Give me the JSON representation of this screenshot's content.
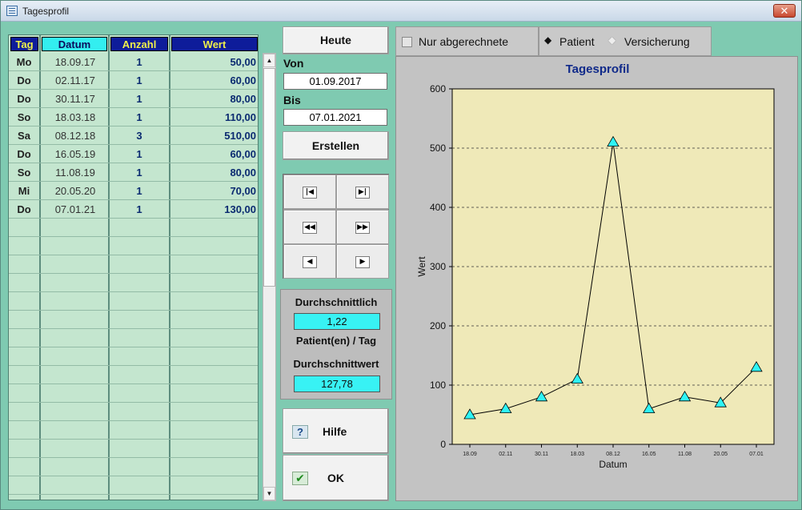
{
  "window": {
    "title": "Tagesprofil",
    "close_label": "✕"
  },
  "table": {
    "headers": {
      "tag": "Tag",
      "datum": "Datum",
      "anzahl": "Anzahl",
      "wert": "Wert"
    },
    "header_colors": {
      "tag": "#0e1c9a",
      "datum": "#33eef0",
      "anzahl": "#0e1c9a",
      "wert": "#0e1c9a"
    },
    "header_text_colors": {
      "tag": "#f0f04a",
      "datum": "#0a0a5a",
      "anzahl": "#f0f04a",
      "wert": "#f0f04a"
    },
    "rows": [
      {
        "tag": "Mo",
        "datum": "18.09.17",
        "anzahl": "1",
        "wert": "50,00"
      },
      {
        "tag": "Do",
        "datum": "02.11.17",
        "anzahl": "1",
        "wert": "60,00"
      },
      {
        "tag": "Do",
        "datum": "30.11.17",
        "anzahl": "1",
        "wert": "80,00"
      },
      {
        "tag": "So",
        "datum": "18.03.18",
        "anzahl": "1",
        "wert": "110,00"
      },
      {
        "tag": "Sa",
        "datum": "08.12.18",
        "anzahl": "3",
        "wert": "510,00"
      },
      {
        "tag": "Do",
        "datum": "16.05.19",
        "anzahl": "1",
        "wert": "60,00"
      },
      {
        "tag": "So",
        "datum": "11.08.19",
        "anzahl": "1",
        "wert": "80,00"
      },
      {
        "tag": "Mi",
        "datum": "20.05.20",
        "anzahl": "1",
        "wert": "70,00"
      },
      {
        "tag": "Do",
        "datum": "07.01.21",
        "anzahl": "1",
        "wert": "130,00"
      }
    ]
  },
  "controls": {
    "today_label": "Heute",
    "from_label": "Von",
    "from_value": "01.09.2017",
    "to_label": "Bis",
    "to_value": "07.01.2021",
    "create_label": "Erstellen"
  },
  "nav": {
    "first_icon": "first-record-icon",
    "last_icon": "last-record-icon",
    "prev_page_icon": "previous-page-icon",
    "next_page_icon": "next-page-icon",
    "prev_icon": "previous-record-icon",
    "next_icon": "next-record-icon"
  },
  "stats": {
    "avg_label": "Durchschnittlich",
    "avg_value": "1,22",
    "per_day_label": "Patient(en) / Tag",
    "avg_value_label": "Durchschnittwert",
    "avg_value_value": "127,78"
  },
  "buttons": {
    "help_label": "Hilfe",
    "ok_label": "OK"
  },
  "options": {
    "only_billed_label": "Nur abgerechnete",
    "only_billed_checked": false,
    "patient_label": "Patient",
    "insurance_label": "Versicherung",
    "selected": "Patient"
  },
  "colors": {
    "plot_bg": "#efe9b8",
    "marker": "#2ef4f5",
    "line": "#000000",
    "title": "#102a8a"
  },
  "chart_data": {
    "type": "line",
    "title": "Tagesprofil",
    "xlabel": "Datum",
    "ylabel": "Wert",
    "categories": [
      "18.09",
      "02.11",
      "30.11",
      "18.03",
      "08.12",
      "16.05",
      "11.08",
      "20.05",
      "07.01"
    ],
    "values": [
      50,
      60,
      80,
      110,
      510,
      60,
      80,
      70,
      130
    ],
    "ylim": [
      0,
      600
    ],
    "yticks": [
      0,
      100,
      200,
      300,
      400,
      500,
      600
    ],
    "grid": "horizontal dashed",
    "marker": "triangle"
  }
}
